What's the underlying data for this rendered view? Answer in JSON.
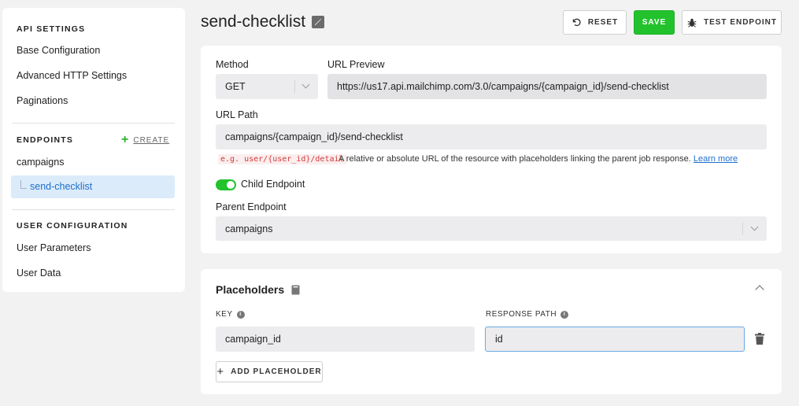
{
  "sidebar": {
    "api_settings_title": "API SETTINGS",
    "api_items": [
      "Base Configuration",
      "Advanced HTTP Settings",
      "Paginations"
    ],
    "endpoints_title": "ENDPOINTS",
    "create_label": "CREATE",
    "endpoints": [
      "campaigns",
      "send-checklist"
    ],
    "user_config_title": "USER CONFIGURATION",
    "user_items": [
      "User Parameters",
      "User Data"
    ]
  },
  "header": {
    "title": "send-checklist",
    "reset_label": "RESET",
    "save_label": "SAVE",
    "test_label": "TEST ENDPOINT"
  },
  "endpoint_form": {
    "method_label": "Method",
    "method_value": "GET",
    "url_preview_label": "URL Preview",
    "url_preview_value": "https://us17.api.mailchimp.com/3.0/campaigns/{campaign_id}/send-checklist",
    "url_path_label": "URL Path",
    "url_path_value": "campaigns/{campaign_id}/send-checklist",
    "hint_example": "e.g. user/{user_id}/detail",
    "hint_text": "A relative or absolute URL of the resource with placeholders linking the parent job response.",
    "learn_more": "Learn more",
    "child_endpoint_label": "Child Endpoint",
    "child_endpoint_on": true,
    "parent_endpoint_label": "Parent Endpoint",
    "parent_endpoint_value": "campaigns"
  },
  "placeholders": {
    "title": "Placeholders",
    "key_header": "KEY",
    "response_path_header": "RESPONSE PATH",
    "rows": [
      {
        "key": "campaign_id",
        "response_path": "id"
      }
    ],
    "add_label": "ADD PLACEHOLDER"
  },
  "colors": {
    "accent_green": "#22c22c",
    "link_blue": "#1d6fcc",
    "selected_bg": "#dcebfa"
  }
}
